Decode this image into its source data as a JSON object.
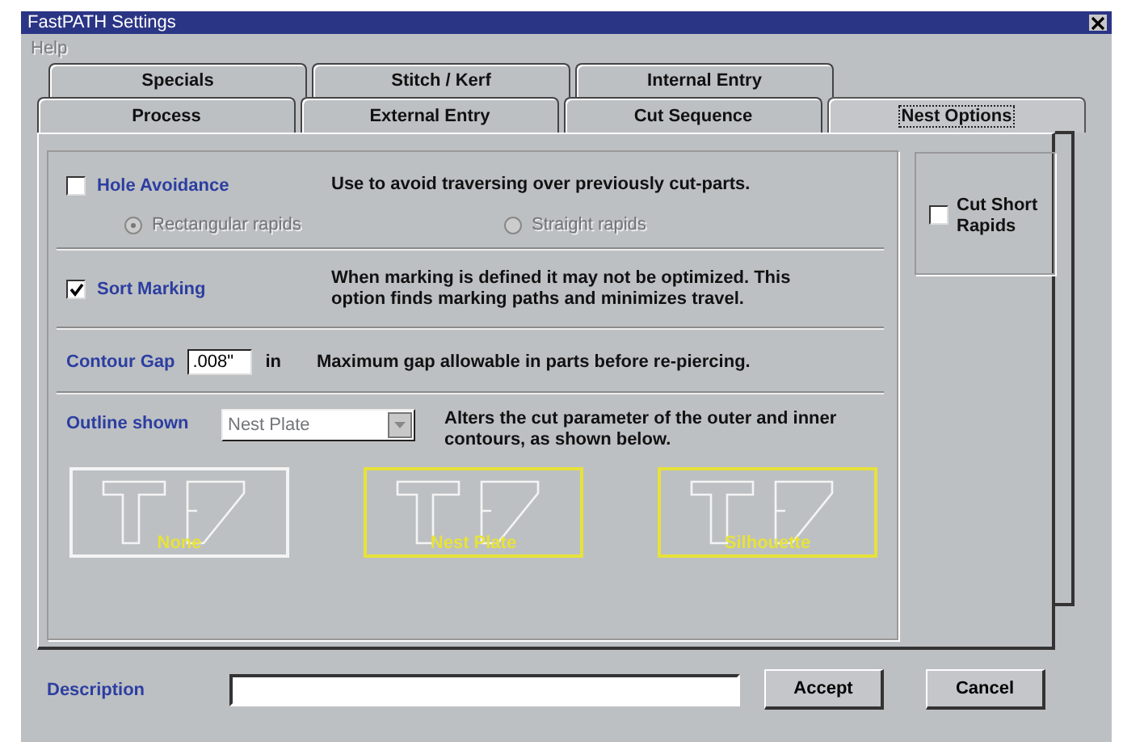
{
  "window": {
    "title": "FastPATH Settings"
  },
  "menu": [
    {
      "label": "Help",
      "disabled": true
    }
  ],
  "tab_rows": [
    [
      {
        "label": "Specials",
        "selected": false
      },
      {
        "label": "Stitch / Kerf",
        "selected": false
      },
      {
        "label": "Internal Entry",
        "selected": false
      }
    ],
    [
      {
        "label": "Process",
        "selected": false
      },
      {
        "label": "External Entry",
        "selected": false
      },
      {
        "label": "Cut Sequence",
        "selected": false
      },
      {
        "label": "Nest Options",
        "selected": true
      }
    ]
  ],
  "hole_avoidance": {
    "label": "Hole Avoidance",
    "checked": false,
    "description": "Use to avoid traversing over previously cut-parts.",
    "disabled_options": true,
    "options": [
      {
        "label": "Rectangular rapids",
        "selected": true
      },
      {
        "label": "Straight rapids",
        "selected": false
      }
    ]
  },
  "sort_marking": {
    "label": "Sort Marking",
    "checked": true,
    "description": "When marking is defined it may not be optimized.  This option finds marking paths and minimizes travel."
  },
  "contour_gap": {
    "label": "Contour Gap",
    "value": ".008\"",
    "unit": "in",
    "description": "Maximum gap allowable in parts before re-piercing."
  },
  "outline": {
    "label": "Outline shown",
    "value": "Nest Plate",
    "disabled": true,
    "description": "Alters the cut parameter of the outer and inner contours, as shown below.",
    "previews": [
      {
        "label": "None",
        "highlighted": false
      },
      {
        "label": "Nest Plate",
        "highlighted": true
      },
      {
        "label": "Silhouette",
        "highlighted": true
      }
    ]
  },
  "cut_short_rapids": {
    "label": "Cut Short Rapids",
    "checked": false
  },
  "description": {
    "label": "Description"
  },
  "buttons": [
    "Accept",
    "Cancel"
  ]
}
